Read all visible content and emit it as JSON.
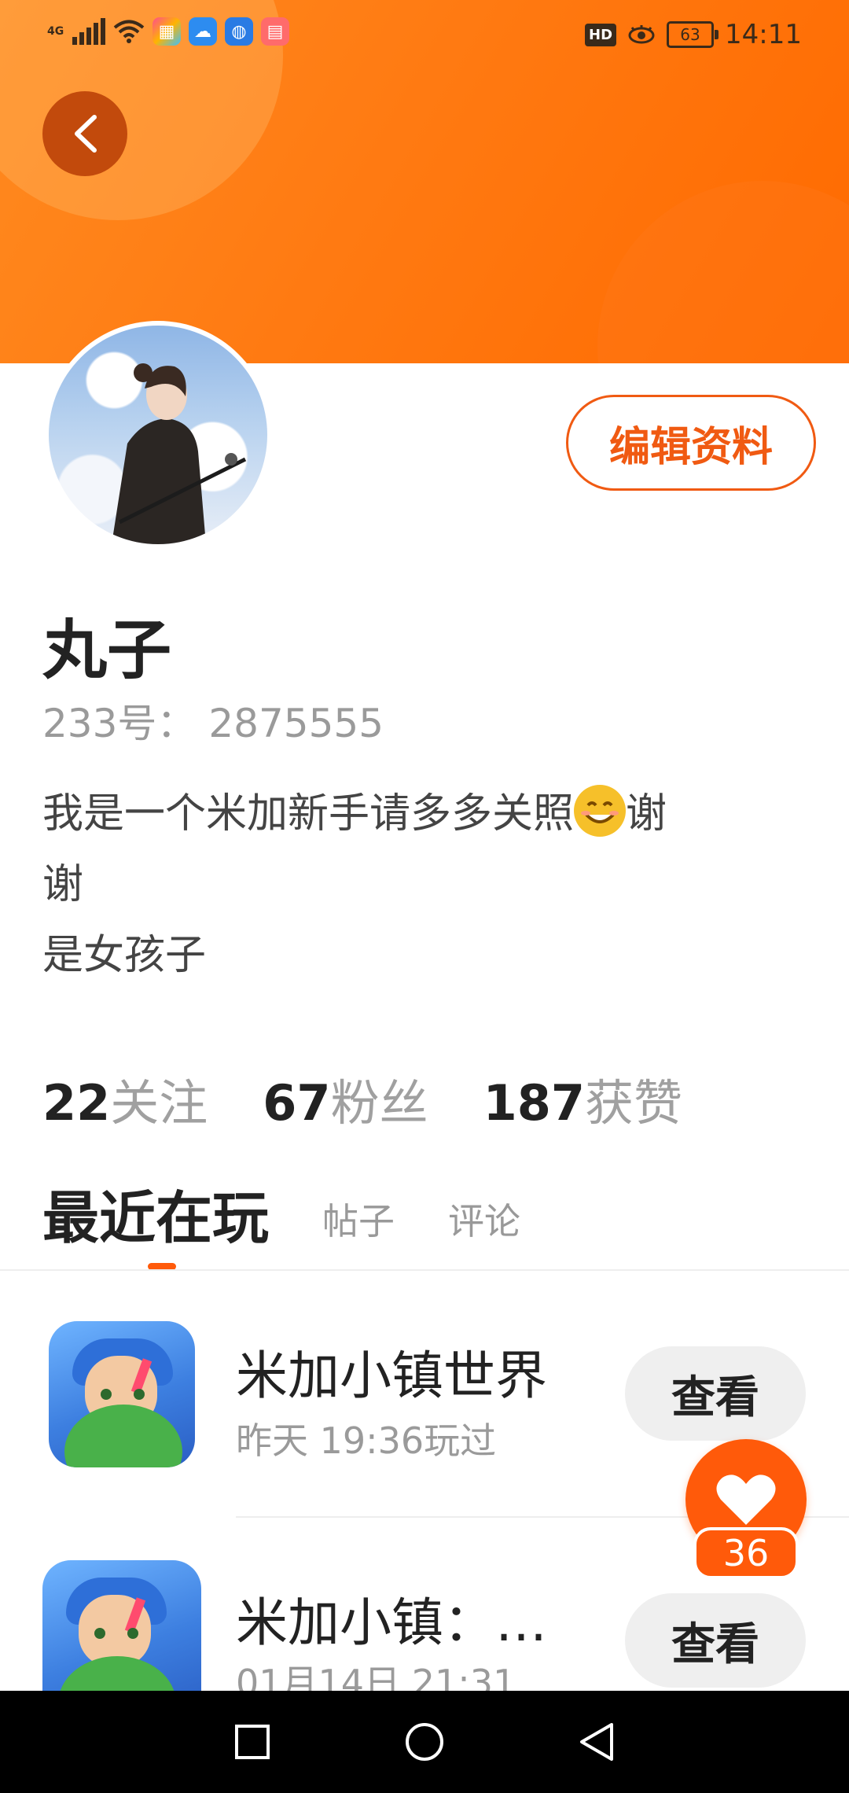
{
  "status_bar": {
    "network": "4G",
    "hd": "HD",
    "battery": "63",
    "time": "14:11"
  },
  "profile": {
    "name": "丸子",
    "id_line": "233号：  2875555",
    "edit_label": "编辑资料",
    "bio_line1_before_emoji": "我是一个米加新手请多多关照",
    "bio_line1_after_emoji": "谢",
    "bio_line2": "谢",
    "bio_line3": "是女孩子"
  },
  "stats": [
    {
      "value": "22",
      "label": "关注"
    },
    {
      "value": "67",
      "label": "粉丝"
    },
    {
      "value": "187",
      "label": "获赞"
    }
  ],
  "tabs": {
    "active": "最近在玩",
    "posts": "帖子",
    "comments": "评论"
  },
  "games": [
    {
      "title": "米加小镇世界",
      "subtitle": "昨天 19:36玩过",
      "button": "查看"
    },
    {
      "title": "米加小镇：…",
      "subtitle": "01月14日 21:31",
      "button": "查看"
    }
  ],
  "like": {
    "count": "36"
  },
  "colors": {
    "accent": "#ff5a0a",
    "banner": "#ff7a12"
  }
}
